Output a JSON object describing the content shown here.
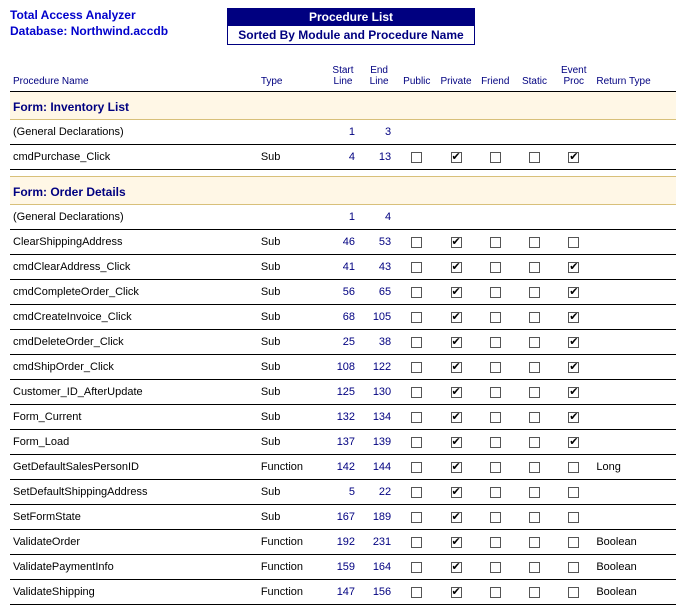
{
  "header": {
    "app_title": "Total Access Analyzer",
    "db_label": "Database:",
    "db_name": "Northwind.accdb",
    "banner_title": "Procedure List",
    "banner_subtitle": "Sorted By Module and Procedure Name"
  },
  "columns": {
    "proc_name": "Procedure Name",
    "type": "Type",
    "start": "Start\nLine",
    "end": "End\nLine",
    "public": "Public",
    "private": "Private",
    "friend": "Friend",
    "static": "Static",
    "event": "Event\nProc",
    "ret": "Return Type"
  },
  "sections": [
    {
      "title": "Form: Inventory List",
      "rows": [
        {
          "name": "(General Declarations)",
          "type": "",
          "start": 1,
          "end": 3,
          "flags": null,
          "ret": ""
        },
        {
          "name": "cmdPurchase_Click",
          "type": "Sub",
          "start": 4,
          "end": 13,
          "flags": {
            "public": false,
            "private": true,
            "friend": false,
            "static": false,
            "event": true
          },
          "ret": ""
        }
      ]
    },
    {
      "title": "Form: Order Details",
      "rows": [
        {
          "name": "(General Declarations)",
          "type": "",
          "start": 1,
          "end": 4,
          "flags": null,
          "ret": ""
        },
        {
          "name": "ClearShippingAddress",
          "type": "Sub",
          "start": 46,
          "end": 53,
          "flags": {
            "public": false,
            "private": true,
            "friend": false,
            "static": false,
            "event": false
          },
          "ret": ""
        },
        {
          "name": "cmdClearAddress_Click",
          "type": "Sub",
          "start": 41,
          "end": 43,
          "flags": {
            "public": false,
            "private": true,
            "friend": false,
            "static": false,
            "event": true
          },
          "ret": ""
        },
        {
          "name": "cmdCompleteOrder_Click",
          "type": "Sub",
          "start": 56,
          "end": 65,
          "flags": {
            "public": false,
            "private": true,
            "friend": false,
            "static": false,
            "event": true
          },
          "ret": ""
        },
        {
          "name": "cmdCreateInvoice_Click",
          "type": "Sub",
          "start": 68,
          "end": 105,
          "flags": {
            "public": false,
            "private": true,
            "friend": false,
            "static": false,
            "event": true
          },
          "ret": ""
        },
        {
          "name": "cmdDeleteOrder_Click",
          "type": "Sub",
          "start": 25,
          "end": 38,
          "flags": {
            "public": false,
            "private": true,
            "friend": false,
            "static": false,
            "event": true
          },
          "ret": ""
        },
        {
          "name": "cmdShipOrder_Click",
          "type": "Sub",
          "start": 108,
          "end": 122,
          "flags": {
            "public": false,
            "private": true,
            "friend": false,
            "static": false,
            "event": true
          },
          "ret": ""
        },
        {
          "name": "Customer_ID_AfterUpdate",
          "type": "Sub",
          "start": 125,
          "end": 130,
          "flags": {
            "public": false,
            "private": true,
            "friend": false,
            "static": false,
            "event": true
          },
          "ret": ""
        },
        {
          "name": "Form_Current",
          "type": "Sub",
          "start": 132,
          "end": 134,
          "flags": {
            "public": false,
            "private": true,
            "friend": false,
            "static": false,
            "event": true
          },
          "ret": ""
        },
        {
          "name": "Form_Load",
          "type": "Sub",
          "start": 137,
          "end": 139,
          "flags": {
            "public": false,
            "private": true,
            "friend": false,
            "static": false,
            "event": true
          },
          "ret": ""
        },
        {
          "name": "GetDefaultSalesPersonID",
          "type": "Function",
          "start": 142,
          "end": 144,
          "flags": {
            "public": false,
            "private": true,
            "friend": false,
            "static": false,
            "event": false
          },
          "ret": "Long"
        },
        {
          "name": "SetDefaultShippingAddress",
          "type": "Sub",
          "start": 5,
          "end": 22,
          "flags": {
            "public": false,
            "private": true,
            "friend": false,
            "static": false,
            "event": false
          },
          "ret": ""
        },
        {
          "name": "SetFormState",
          "type": "Sub",
          "start": 167,
          "end": 189,
          "flags": {
            "public": false,
            "private": true,
            "friend": false,
            "static": false,
            "event": false
          },
          "ret": ""
        },
        {
          "name": "ValidateOrder",
          "type": "Function",
          "start": 192,
          "end": 231,
          "flags": {
            "public": false,
            "private": true,
            "friend": false,
            "static": false,
            "event": false
          },
          "ret": "Boolean"
        },
        {
          "name": "ValidatePaymentInfo",
          "type": "Function",
          "start": 159,
          "end": 164,
          "flags": {
            "public": false,
            "private": true,
            "friend": false,
            "static": false,
            "event": false
          },
          "ret": "Boolean"
        },
        {
          "name": "ValidateShipping",
          "type": "Function",
          "start": 147,
          "end": 156,
          "flags": {
            "public": false,
            "private": true,
            "friend": false,
            "static": false,
            "event": false
          },
          "ret": "Boolean"
        }
      ]
    }
  ]
}
